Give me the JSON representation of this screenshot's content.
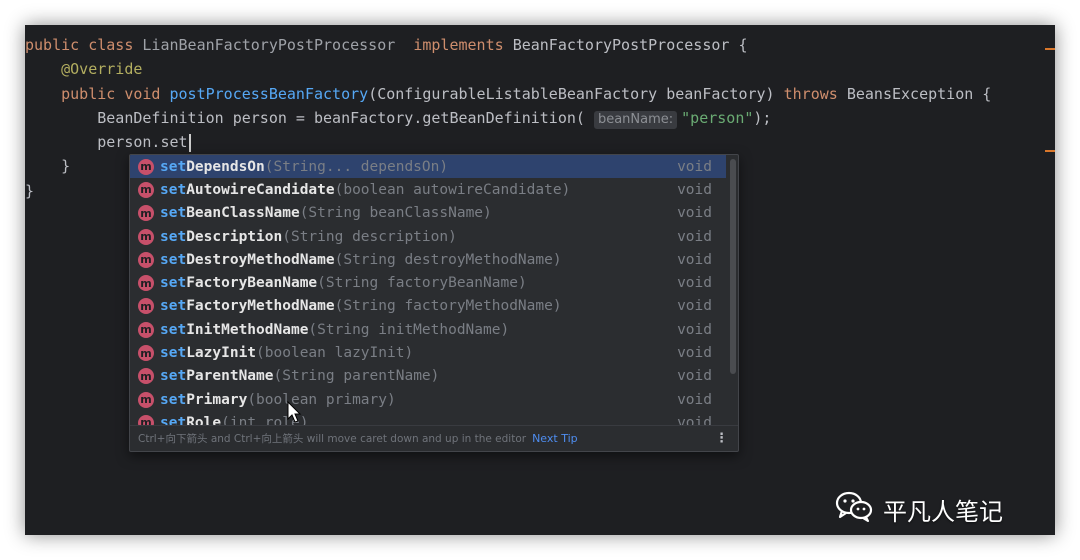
{
  "editor": {
    "lines": [
      {
        "parts": [
          {
            "t": "public class ",
            "c": "kw"
          },
          {
            "t": "LianBeanFactoryPostProcessor  ",
            "c": "cls"
          },
          {
            "t": "implements ",
            "c": "kw"
          },
          {
            "t": "BeanFactoryPostProcessor {",
            "c": "plain"
          }
        ]
      },
      {
        "parts": [
          {
            "t": "    ",
            "c": "plain"
          },
          {
            "t": "@Override",
            "c": "ann"
          }
        ]
      },
      {
        "parts": [
          {
            "t": "    ",
            "c": "plain"
          },
          {
            "t": "public void ",
            "c": "kw"
          },
          {
            "t": "postProcessBeanFactory",
            "c": "fn"
          },
          {
            "t": "(ConfigurableListableBeanFactory beanFactory) ",
            "c": "plain"
          },
          {
            "t": "throws ",
            "c": "kw"
          },
          {
            "t": "BeansException {",
            "c": "plain"
          }
        ]
      },
      {
        "parts": [
          {
            "t": "        BeanDefinition person = beanFactory.getBeanDefinition( ",
            "c": "plain"
          },
          {
            "t": "beanName:",
            "c": "hint"
          },
          {
            "t": "\"person\"",
            "c": "str"
          },
          {
            "t": ");",
            "c": "plain"
          }
        ]
      },
      {
        "parts": [
          {
            "t": "        person.set",
            "c": "plain"
          }
        ],
        "caret": true
      },
      {
        "parts": [
          {
            "t": "    }",
            "c": "plain"
          }
        ]
      },
      {
        "parts": [
          {
            "t": "}",
            "c": "plain"
          }
        ]
      }
    ]
  },
  "completion": {
    "items": [
      {
        "prefix": "set",
        "rest": "DependsOn",
        "params": "(String... dependsOn)",
        "type": "void",
        "selected": true
      },
      {
        "prefix": "set",
        "rest": "AutowireCandidate",
        "params": "(boolean autowireCandidate)",
        "type": "void"
      },
      {
        "prefix": "set",
        "rest": "BeanClassName",
        "params": "(String beanClassName)",
        "type": "void"
      },
      {
        "prefix": "set",
        "rest": "Description",
        "params": "(String description)",
        "type": "void"
      },
      {
        "prefix": "set",
        "rest": "DestroyMethodName",
        "params": "(String destroyMethodName)",
        "type": "void"
      },
      {
        "prefix": "set",
        "rest": "FactoryBeanName",
        "params": "(String factoryBeanName)",
        "type": "void"
      },
      {
        "prefix": "set",
        "rest": "FactoryMethodName",
        "params": "(String factoryMethodName)",
        "type": "void"
      },
      {
        "prefix": "set",
        "rest": "InitMethodName",
        "params": "(String initMethodName)",
        "type": "void"
      },
      {
        "prefix": "set",
        "rest": "LazyInit",
        "params": "(boolean lazyInit)",
        "type": "void"
      },
      {
        "prefix": "set",
        "rest": "ParentName",
        "params": "(String parentName)",
        "type": "void"
      },
      {
        "prefix": "set",
        "rest": "Primary",
        "params": "(boolean primary)",
        "type": "void"
      },
      {
        "prefix": "set",
        "rest": "Role",
        "params": "(int role)",
        "type": "void"
      }
    ],
    "badge": "m",
    "footer_tip": "Ctrl+向下箭头 and Ctrl+向上箭头 will move caret down and up in the editor",
    "footer_link": "Next Tip",
    "menu_glyph": "⋮"
  },
  "watermark": {
    "text": "平凡人笔记"
  },
  "colors": {
    "background": "#1e1f22",
    "keyword": "#cf8e6d",
    "method": "#56a8f5",
    "annotation": "#b3ae60",
    "string": "#6aab73",
    "selection": "#2e436e",
    "badge": "#c7506a"
  },
  "icons": {
    "method_badge": "method-icon",
    "mouse_pointer": "mouse-pointer-icon",
    "wechat": "wechat-icon",
    "menu": "kebab-menu-icon"
  }
}
